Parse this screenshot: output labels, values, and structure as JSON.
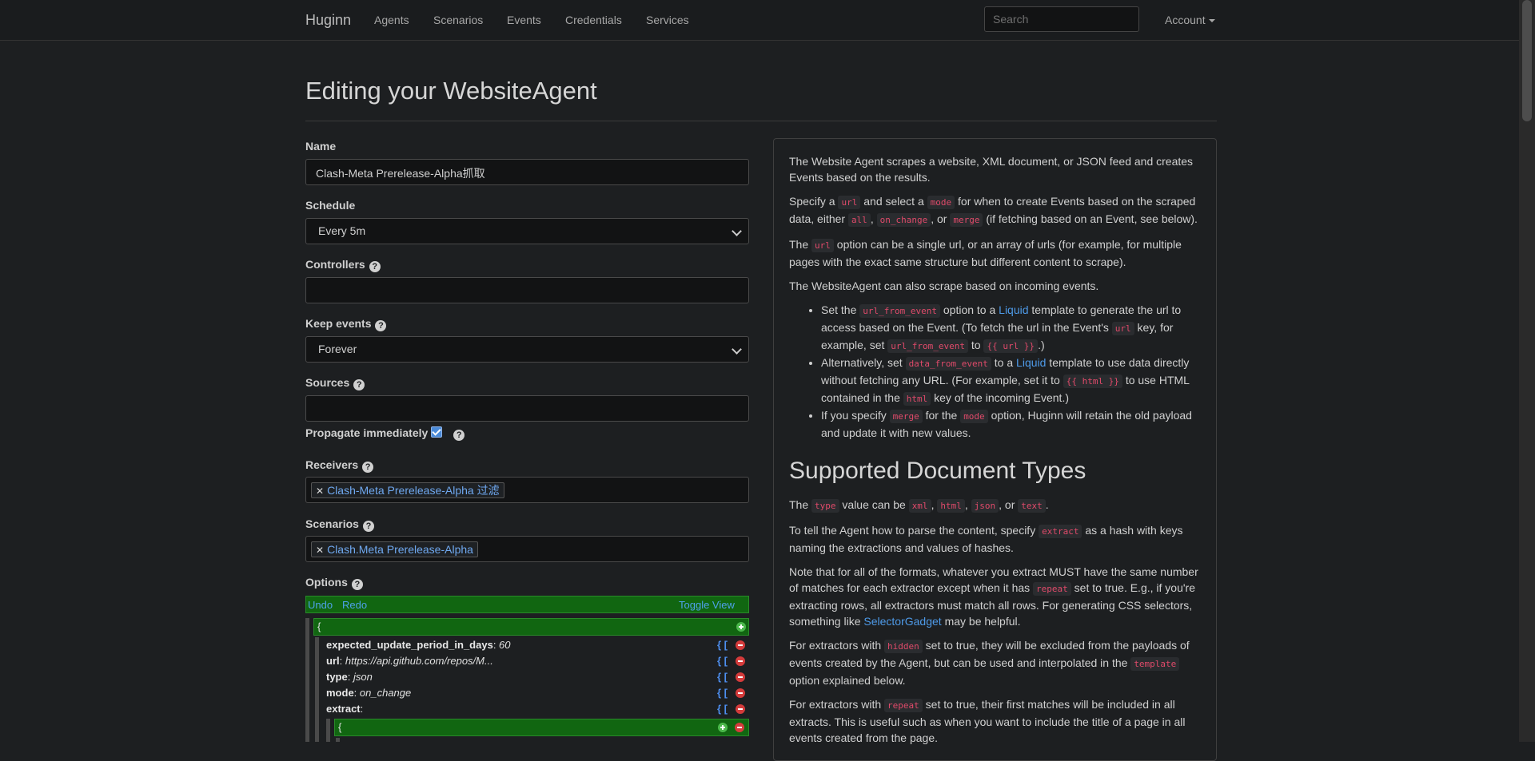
{
  "nav": {
    "brand": "Huginn",
    "items": [
      "Agents",
      "Scenarios",
      "Events",
      "Credentials",
      "Services"
    ],
    "search_placeholder": "Search",
    "account": "Account"
  },
  "page_title": "Editing your WebsiteAgent",
  "form": {
    "name_label": "Name",
    "name_value": "Clash-Meta Prerelease-Alpha抓取",
    "schedule_label": "Schedule",
    "schedule_value": "Every 5m",
    "controllers_label": "Controllers",
    "keep_events_label": "Keep events",
    "keep_events_value": "Forever",
    "sources_label": "Sources",
    "propagate_label": "Propagate immediately",
    "receivers_label": "Receivers",
    "receiver_tag": "Clash-Meta Prerelease-Alpha 过滤",
    "scenarios_label": "Scenarios",
    "scenario_tag": "Clash.Meta Prerelease-Alpha",
    "options_label": "Options"
  },
  "editor": {
    "undo": "Undo",
    "redo": "Redo",
    "toggle": "Toggle View",
    "open_brace": "{",
    "ctl": "{ [",
    "rows": [
      {
        "key": "expected_update_period_in_days",
        "value": "60"
      },
      {
        "key": "url",
        "value": "https://api.github.com/repos/M..."
      },
      {
        "key": "type",
        "value": "json"
      },
      {
        "key": "mode",
        "value": "on_change"
      },
      {
        "key": "extract",
        "value": ""
      }
    ]
  },
  "help": {
    "p1": "The Website Agent scrapes a website, XML document, or JSON feed and creates Events based on the results.",
    "p2": [
      "Specify a ",
      "url",
      " and select a ",
      "mode",
      " for when to create Events based on the scraped data, either ",
      "all",
      ", ",
      "on_change",
      ", or ",
      "merge",
      " (if fetching based on an Event, see below)."
    ],
    "p3": [
      "The ",
      "url",
      " option can be a single url, or an array of urls (for example, for multiple pages with the exact same structure but different content to scrape)."
    ],
    "p4": "The WebsiteAgent can also scrape based on incoming events.",
    "li1": [
      "Set the ",
      "url_from_event",
      " option to a ",
      "Liquid",
      " template to generate the url to access based on the Event. (To fetch the url in the Event's ",
      "url",
      " key, for example, set ",
      "url_from_event",
      " to ",
      "{{ url }}",
      ".)"
    ],
    "li2": [
      "Alternatively, set ",
      "data_from_event",
      " to a ",
      "Liquid",
      " template to use data directly without fetching any URL. (For example, set it to ",
      "{{ html }}",
      " to use HTML contained in the ",
      "html",
      " key of the incoming Event.)"
    ],
    "li3": [
      "If you specify ",
      "merge",
      " for the ",
      "mode",
      " option, Huginn will retain the old payload and update it with new values."
    ],
    "h2": "Supported Document Types",
    "p5": [
      "The ",
      "type",
      " value can be ",
      "xml",
      ", ",
      "html",
      ", ",
      "json",
      ", or ",
      "text",
      "."
    ],
    "p6": [
      "To tell the Agent how to parse the content, specify ",
      "extract",
      " as a hash with keys naming the extractions and values of hashes."
    ],
    "p7": [
      "Note that for all of the formats, whatever you extract MUST have the same number of matches for each extractor except when it has ",
      "repeat",
      " set to true. E.g., if you're extracting rows, all extractors must match all rows. For generating CSS selectors, something like ",
      "SelectorGadget",
      " may be helpful."
    ],
    "p8": [
      "For extractors with ",
      "hidden",
      " set to true, they will be excluded from the payloads of events created by the Agent, but can be used and interpolated in the ",
      "template",
      " option explained below."
    ],
    "p9": [
      "For extractors with ",
      "repeat",
      " set to true, their first matches will be included in all extracts. This is useful such as when you want to include the title of a page in all events created from the page."
    ]
  }
}
